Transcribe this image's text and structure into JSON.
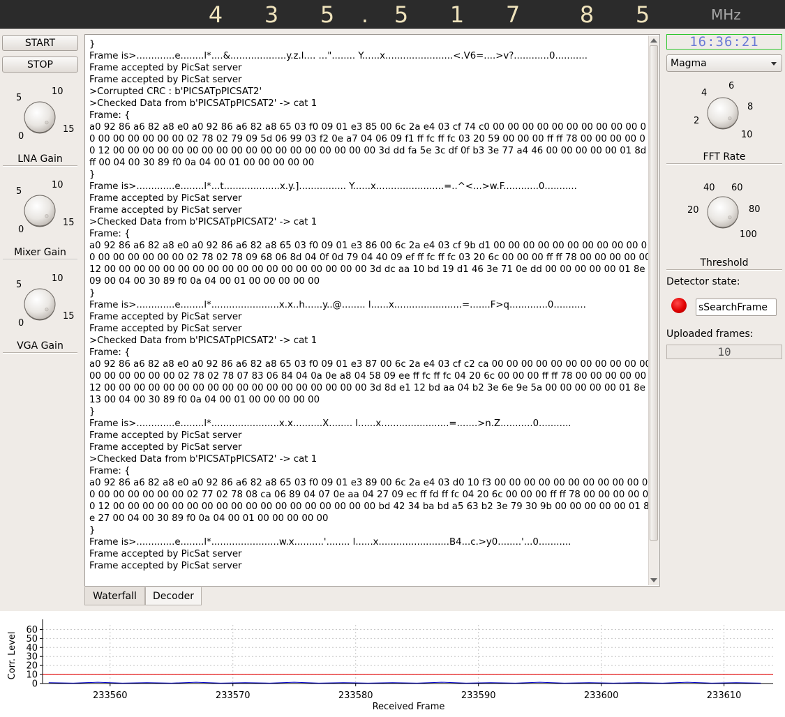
{
  "frequency": {
    "digits": [
      "4",
      "3",
      "5",
      ".",
      "5",
      "1",
      "7",
      "8",
      "5"
    ],
    "unit": "MHz"
  },
  "controls": {
    "start_label": "START",
    "stop_label": "STOP",
    "knobs": [
      {
        "name": "LNA Gain",
        "ticks": [
          "5",
          "10",
          "0",
          "15"
        ]
      },
      {
        "name": "Mixer Gain",
        "ticks": [
          "5",
          "10",
          "0",
          "15"
        ]
      },
      {
        "name": "VGA Gain",
        "ticks": [
          "5",
          "10",
          "0",
          "15"
        ]
      }
    ]
  },
  "log": {
    "text": "}\nFrame is>.............e........l*....&...................y.z.l.... ...\"........ Y......x.......................<.V6=....>v?............0...........\nFrame accepted by PicSat server\nFrame accepted by PicSat server\n>Corrupted CRC : b'PICSATpPICSAT2'\n>Checked Data from b'PICSATpPICSAT2' -> cat 1\nFrame: {\na0 92 86 a6 82 a8 e0 a0 92 86 a6 82 a8 65 03 f0 09 01 e3 85 00 6c 2a e4 03 cf 74 c0 00 00 00 00 00 00 00 00 00 00 00 00 00 00 00 00 00 02 78 02 79 09 5d 06 99 03 f2 0e a7 04 06 09 f1 ff fc ff fc 03 20 59 00 00 00 ff ff 78 00 00 00 00 00 12 00 00 00 00 00 00 00 00 00 00 00 00 00 00 00 00 00 00 3d dd fa 5e 3c df 0f b3 3e 77 a4 46 00 00 00 00 00 01 8d ff 00 04 00 30 89 f0 0a 04 00 01 00 00 00 00 00\n}\nFrame is>.............e........l*...t...................x.y.]................ Y......x.......................=..^<...>w.F............0...........\nFrame accepted by PicSat server\nFrame accepted by PicSat server\n>Checked Data from b'PICSATpPICSAT2' -> cat 1\nFrame: {\na0 92 86 a6 82 a8 e0 a0 92 86 a6 82 a8 65 03 f0 09 01 e3 86 00 6c 2a e4 03 cf 9b d1 00 00 00 00 00 00 00 00 00 00 00 00 00 00 00 00 00 02 78 02 78 09 68 06 8d 04 0f 0d 79 04 40 09 ef ff fc ff fc 03 20 6c 00 00 00 ff ff 78 00 00 00 00 00 12 00 00 00 00 00 00 00 00 00 00 00 00 00 00 00 00 00 00 3d dc aa 10 bd 19 d1 46 3e 71 0e dd 00 00 00 00 00 01 8e 09 00 04 00 30 89 f0 0a 04 00 01 00 00 00 00 00\n}\nFrame is>.............e........l*.......................x.x..h......y..@........ l......x.......................=.......F>q.............0...........\nFrame accepted by PicSat server\nFrame accepted by PicSat server\n>Checked Data from b'PICSATpPICSAT2' -> cat 1\nFrame: {\na0 92 86 a6 82 a8 e0 a0 92 86 a6 82 a8 65 03 f0 09 01 e3 87 00 6c 2a e4 03 cf c2 ca 00 00 00 00 00 00 00 00 00 00 00 00 00 00 00 00 00 02 78 02 78 07 83 06 84 04 0a 0e a8 04 58 09 ee ff fc ff fc 04 20 6c 00 00 00 ff ff 78 00 00 00 00 00 12 00 00 00 00 00 00 00 00 00 00 00 00 00 00 00 00 00 00 3d 8d e1 12 bd aa 04 b2 3e 6e 9e 5a 00 00 00 00 00 01 8e 13 00 04 00 30 89 f0 0a 04 00 01 00 00 00 00 00\n}\nFrame is>.............e........l*.......................x.x..........X........ l......x.......................=.......>n.Z...........0...........\nFrame accepted by PicSat server\nFrame accepted by PicSat server\n>Checked Data from b'PICSATpPICSAT2' -> cat 1\nFrame: {\na0 92 86 a6 82 a8 e0 a0 92 86 a6 82 a8 65 03 f0 09 01 e3 89 00 6c 2a e4 03 d0 10 f3 00 00 00 00 00 00 00 00 00 00 00 00 00 00 00 00 00 02 77 02 78 08 ca 06 89 04 07 0e aa 04 27 09 ec ff fd ff fc 04 20 6c 00 00 00 ff ff 78 00 00 00 00 00 12 00 00 00 00 00 00 00 00 00 00 00 00 00 00 00 00 00 00 bd 42 34 ba bd a5 63 b2 3e 79 30 9b 00 00 00 00 00 01 8e 27 00 04 00 30 89 f0 0a 04 00 01 00 00 00 00 00\n}\nFrame is>.............e........l*.......................w.x..........'........ l......x........................B4...c.>y0........'...0...........\nFrame accepted by PicSat server\nFrame accepted by PicSat server"
  },
  "tabs": [
    "Waterfall",
    "Decoder"
  ],
  "right_panel": {
    "clock": "16:36:21",
    "colormap": "Magma",
    "fft_rate": {
      "label": "FFT Rate",
      "ticks": [
        "6",
        "4",
        "8",
        "2",
        "10"
      ]
    },
    "threshold": {
      "label": "Threshold",
      "ticks": [
        "40",
        "60",
        "20",
        "80",
        "100"
      ]
    },
    "detector_label": "Detector state:",
    "detector_state": "sSearchFrame",
    "detector_led_color": "#e00000",
    "uploaded_label": "Uploaded frames:",
    "uploaded_count": "10"
  },
  "chart_data": {
    "type": "line",
    "xlabel": "Received Frame",
    "ylabel": "Corr. Level",
    "x_ticks": [
      233560,
      233570,
      233580,
      233590,
      233600,
      233610
    ],
    "y_ticks": [
      0,
      10,
      20,
      30,
      40,
      50,
      60
    ],
    "xlim": [
      233554.5,
      233614
    ],
    "ylim": [
      0,
      65
    ],
    "grid": true,
    "threshold": {
      "value": 10,
      "color": "#e00000"
    },
    "series": [
      {
        "color": "#0000c8",
        "x": [
          233555,
          233557,
          233559,
          233561,
          233563,
          233565,
          233567,
          233569,
          233571,
          233573,
          233575,
          233577,
          233579,
          233581,
          233583,
          233585,
          233587,
          233589,
          233591,
          233593,
          233595,
          233597,
          233599,
          233601,
          233603,
          233605,
          233607,
          233609,
          233611,
          233613
        ],
        "y": [
          1,
          0.5,
          1.5,
          0.5,
          1,
          0.5,
          1.5,
          0.5,
          1,
          0.5,
          1.5,
          0.5,
          1,
          0.5,
          1,
          0.5,
          1.5,
          0.5,
          1,
          0.5,
          1.5,
          0.5,
          1,
          0.5,
          1,
          0.5,
          1.5,
          0.5,
          1,
          0.5
        ]
      }
    ]
  }
}
